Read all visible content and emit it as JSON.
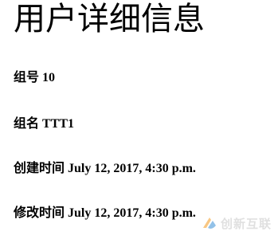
{
  "page": {
    "title": "用户详细信息"
  },
  "fields": [
    {
      "label": "组号",
      "value": "10"
    },
    {
      "label": "组名",
      "value": "TTT1"
    },
    {
      "label": "创建时间",
      "value": "July 12, 2017, 4:30 p.m."
    },
    {
      "label": "修改时间",
      "value": "July 12, 2017, 4:30 p.m."
    }
  ],
  "watermark": {
    "text": "创新互联",
    "icon": "brand-logo-icon",
    "colors": {
      "orange": "#f39a1e",
      "blue": "#3a8fd6"
    }
  }
}
